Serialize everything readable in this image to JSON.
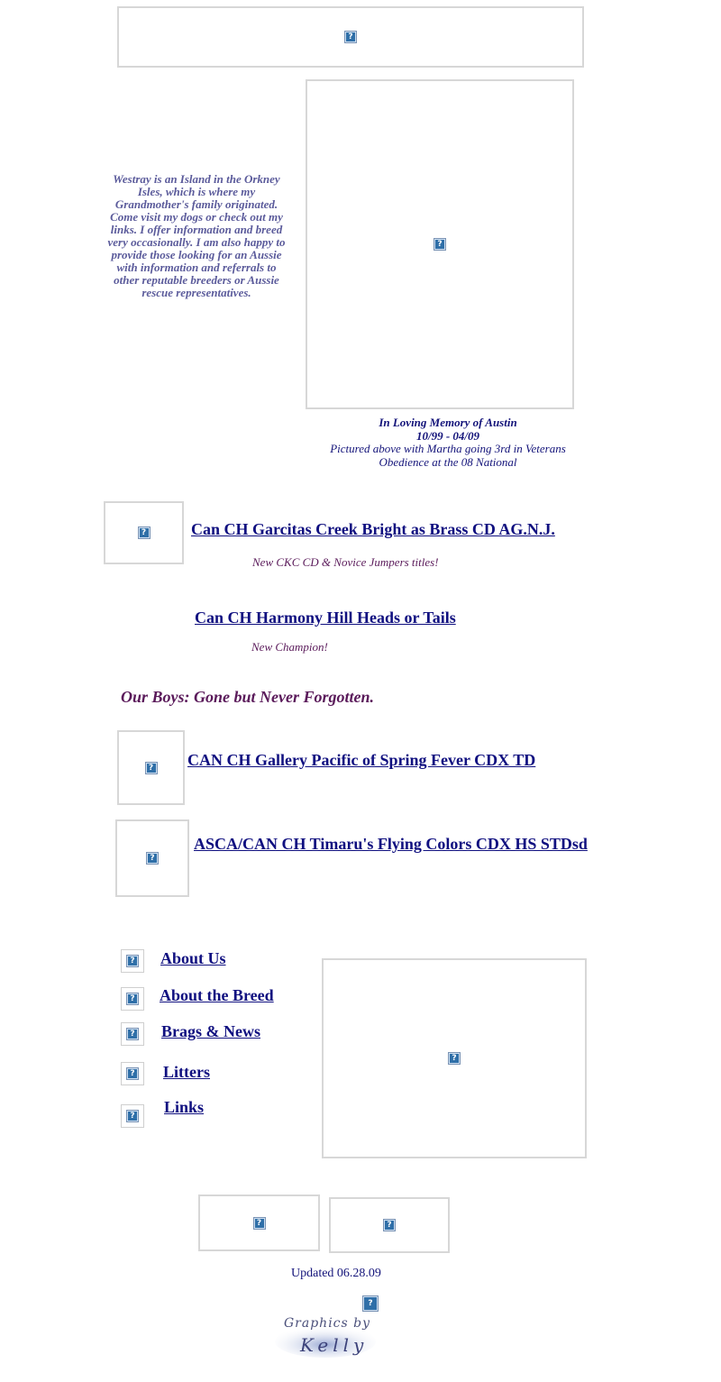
{
  "intro": {
    "text": "Westray is an Island in the Orkney Isles, which is where my Grandmother's family originated. Come visit my dogs or check out my links. I offer information and breed very occasionally. I am also happy to provide those looking for an Aussie with information and referrals to other reputable breeders or Aussie rescue representatives."
  },
  "memory": {
    "line1": "In Loving Memory of Austin",
    "line2": "10/99 - 04/09",
    "line3": "Pictured above with Martha going 3rd in Veterans Obedience at the 08 National"
  },
  "dogs": [
    {
      "name": "Can CH Garcitas Creek Bright as Brass CD AG.N.J.",
      "note": "New CKC CD & Novice Jumpers titles!"
    },
    {
      "name": "Can CH Harmony Hill Heads or Tails",
      "note": "New Champion!"
    }
  ],
  "boys_heading": "Our Boys: Gone but Never Forgotten.",
  "boys": [
    {
      "name": "CAN CH Gallery Pacific of Spring Fever CDX TD"
    },
    {
      "name": "ASCA/CAN CH Timaru's Flying Colors CDX HS STDsd"
    }
  ],
  "nav": [
    {
      "label": "About Us"
    },
    {
      "label": "About the Breed"
    },
    {
      "label": "Brags & News"
    },
    {
      "label": "Litters"
    },
    {
      "label": "Links"
    }
  ],
  "broken_image_glyph": "?",
  "updated": "Updated 06.28.09",
  "credit": {
    "line1": "Graphics by",
    "line2": "Kelly"
  },
  "colors": {
    "link": "#101080",
    "note": "#5a1a5a",
    "intro": "#5b5b9b",
    "border": "#d7d7d7"
  }
}
